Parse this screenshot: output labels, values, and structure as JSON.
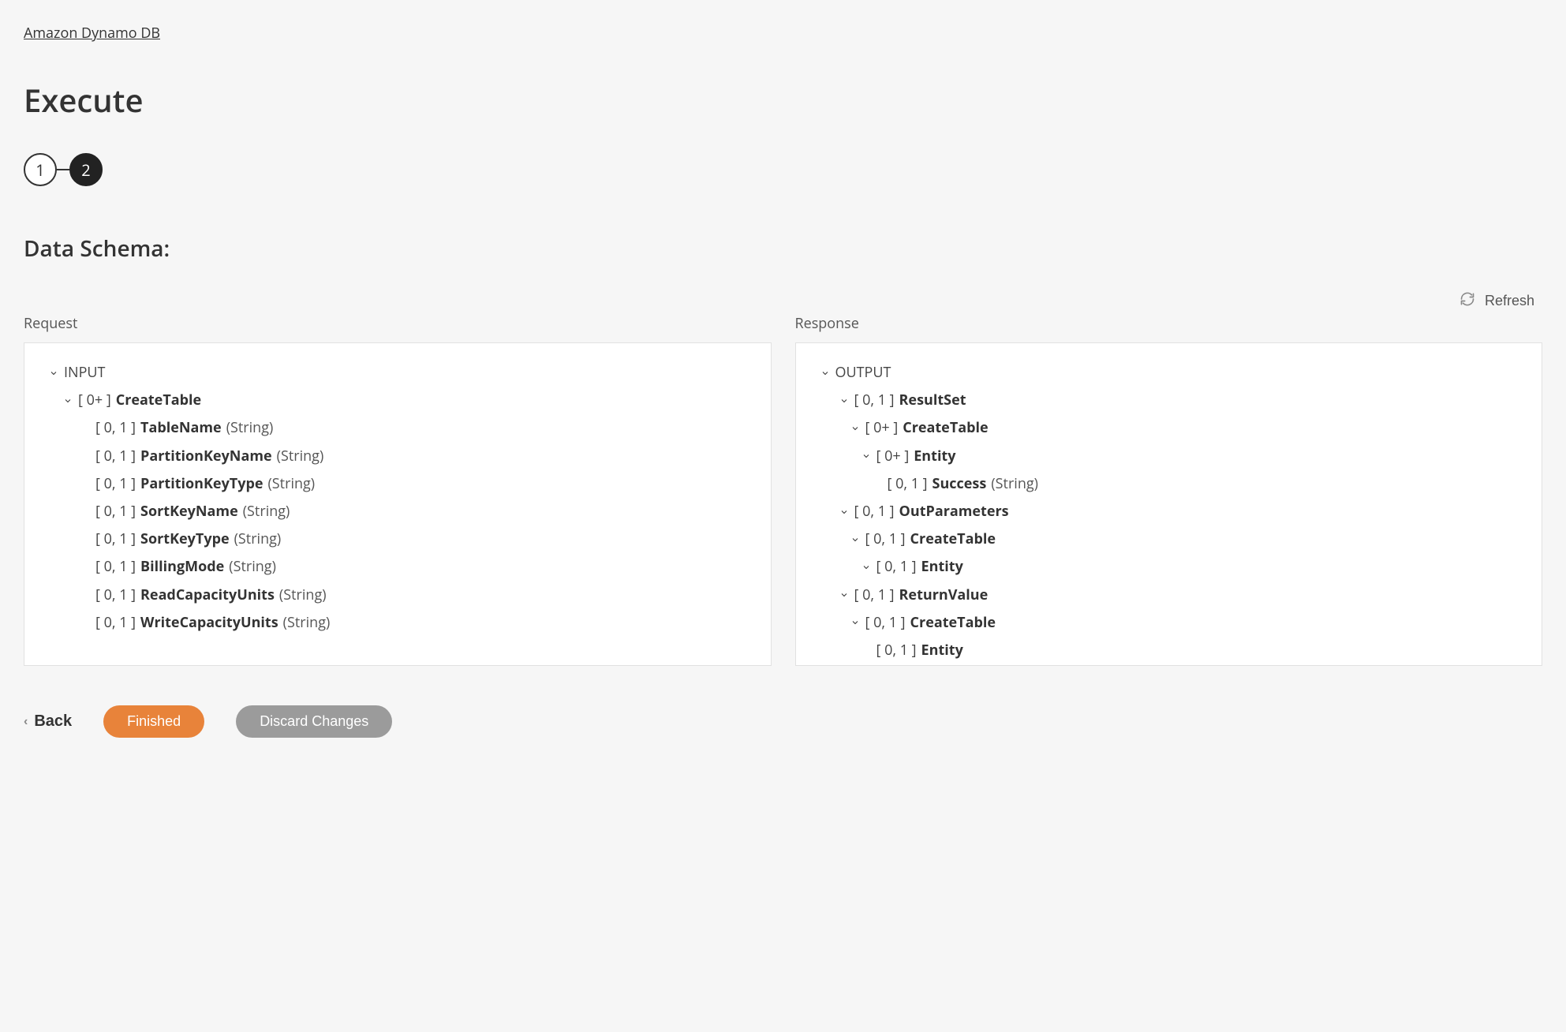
{
  "breadcrumb": "Amazon Dynamo DB",
  "pageTitle": "Execute",
  "steps": {
    "one": "1",
    "two": "2"
  },
  "sectionTitle": "Data Schema:",
  "refreshLabel": "Refresh",
  "request": {
    "label": "Request",
    "rootLabel": "INPUT",
    "rootCard": "[ 0+ ]",
    "rootName": "CreateTable",
    "items": [
      {
        "card": "[ 0, 1 ]",
        "name": "TableName",
        "type": "(String)"
      },
      {
        "card": "[ 0, 1 ]",
        "name": "PartitionKeyName",
        "type": "(String)"
      },
      {
        "card": "[ 0, 1 ]",
        "name": "PartitionKeyType",
        "type": "(String)"
      },
      {
        "card": "[ 0, 1 ]",
        "name": "SortKeyName",
        "type": "(String)"
      },
      {
        "card": "[ 0, 1 ]",
        "name": "SortKeyType",
        "type": "(String)"
      },
      {
        "card": "[ 0, 1 ]",
        "name": "BillingMode",
        "type": "(String)"
      },
      {
        "card": "[ 0, 1 ]",
        "name": "ReadCapacityUnits",
        "type": "(String)"
      },
      {
        "card": "[ 0, 1 ]",
        "name": "WriteCapacityUnits",
        "type": "(String)"
      }
    ]
  },
  "response": {
    "label": "Response",
    "rootLabel": "OUTPUT",
    "nodes": [
      {
        "indent": 1,
        "chev": true,
        "card": "[ 0, 1 ]",
        "name": "ResultSet",
        "type": ""
      },
      {
        "indent": 2,
        "chev": true,
        "card": "[ 0+ ]",
        "name": "CreateTable",
        "type": ""
      },
      {
        "indent": 3,
        "chev": true,
        "card": "[ 0+ ]",
        "name": "Entity",
        "type": ""
      },
      {
        "indent": 4,
        "chev": false,
        "card": "[ 0, 1 ]",
        "name": "Success",
        "type": "(String)"
      },
      {
        "indent": 1,
        "chev": true,
        "card": "[ 0, 1 ]",
        "name": "OutParameters",
        "type": ""
      },
      {
        "indent": 2,
        "chev": true,
        "card": "[ 0, 1 ]",
        "name": "CreateTable",
        "type": ""
      },
      {
        "indent": 3,
        "chev": true,
        "card": "[ 0, 1 ]",
        "name": "Entity",
        "type": ""
      },
      {
        "indent": 1,
        "chev": true,
        "card": "[ 0, 1 ]",
        "name": "ReturnValue",
        "type": ""
      },
      {
        "indent": 2,
        "chev": true,
        "card": "[ 0, 1 ]",
        "name": "CreateTable",
        "type": ""
      },
      {
        "indent": 3,
        "chev": false,
        "card": "[ 0, 1 ]",
        "name": "Entity",
        "type": ""
      }
    ]
  },
  "footer": {
    "back": "Back",
    "finished": "Finished",
    "discard": "Discard Changes"
  }
}
